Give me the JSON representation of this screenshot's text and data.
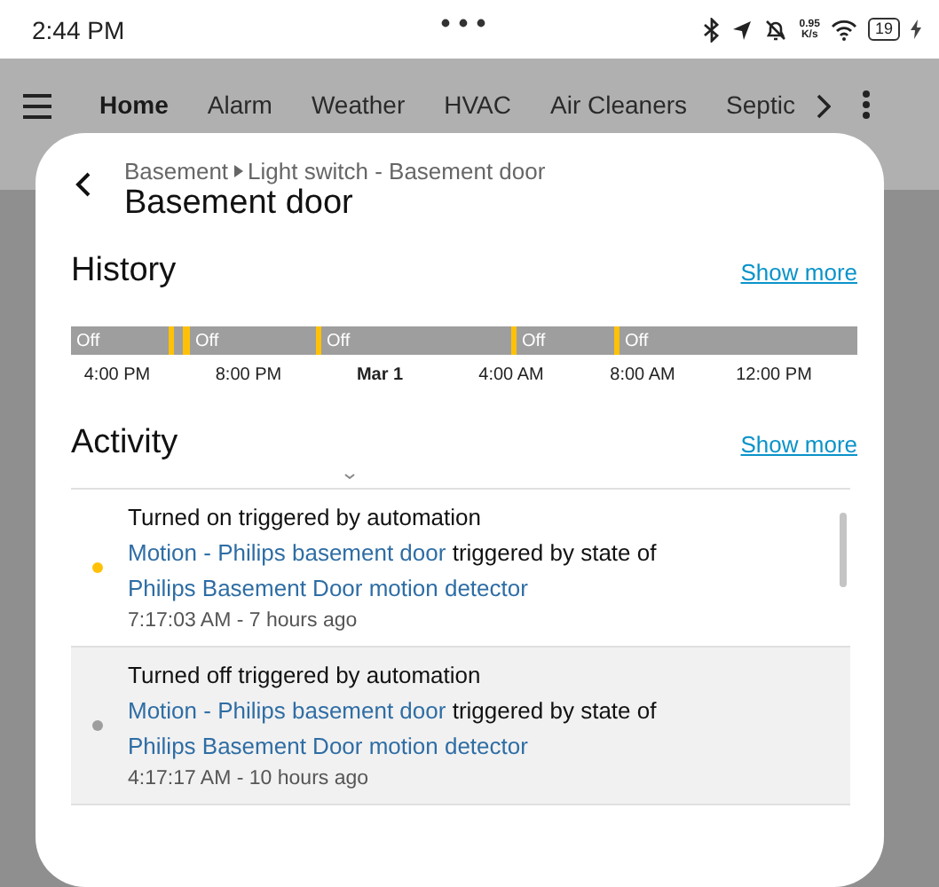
{
  "status_bar": {
    "time": "2:44 PM",
    "net_speed": "0.95",
    "net_unit": "K/s",
    "battery": "19"
  },
  "tabs": [
    {
      "label": "Home",
      "selected": true
    },
    {
      "label": "Alarm",
      "selected": false
    },
    {
      "label": "Weather",
      "selected": false
    },
    {
      "label": "HVAC",
      "selected": false
    },
    {
      "label": "Air Cleaners",
      "selected": false
    },
    {
      "label": "Septic",
      "selected": false
    }
  ],
  "dialog": {
    "breadcrumb": [
      "Basement",
      "Light switch - Basement door"
    ],
    "title": "Basement door",
    "history": {
      "heading": "History",
      "show_more": "Show more",
      "segment_labels": [
        "Off",
        "Off",
        "Off",
        "Off",
        "Off"
      ],
      "ticks": [
        {
          "label": "4:00 PM",
          "kind": "time"
        },
        {
          "label": "8:00 PM",
          "kind": "time"
        },
        {
          "label": "Mar 1",
          "kind": "date"
        },
        {
          "label": "4:00 AM",
          "kind": "time"
        },
        {
          "label": "8:00 AM",
          "kind": "time"
        },
        {
          "label": "12:00 PM",
          "kind": "time"
        }
      ]
    },
    "activity": {
      "heading": "Activity",
      "show_more": "Show more",
      "entries": [
        {
          "title": "Turned on triggered by automation",
          "source": "Motion - Philips basement door",
          "middle": "triggered by state of",
          "target": "Philips Basement Door motion detector",
          "time": "7:17:03 AM - 7 hours ago",
          "color": "#ffc107",
          "highlighted": false
        },
        {
          "title": "Turned off triggered by automation",
          "source": "Motion - Philips basement door",
          "middle": "triggered by state of",
          "target": "Philips Basement Door motion detector",
          "time": "4:17:17 AM - 10 hours ago",
          "color": "#9e9e9e",
          "highlighted": true
        }
      ]
    }
  }
}
